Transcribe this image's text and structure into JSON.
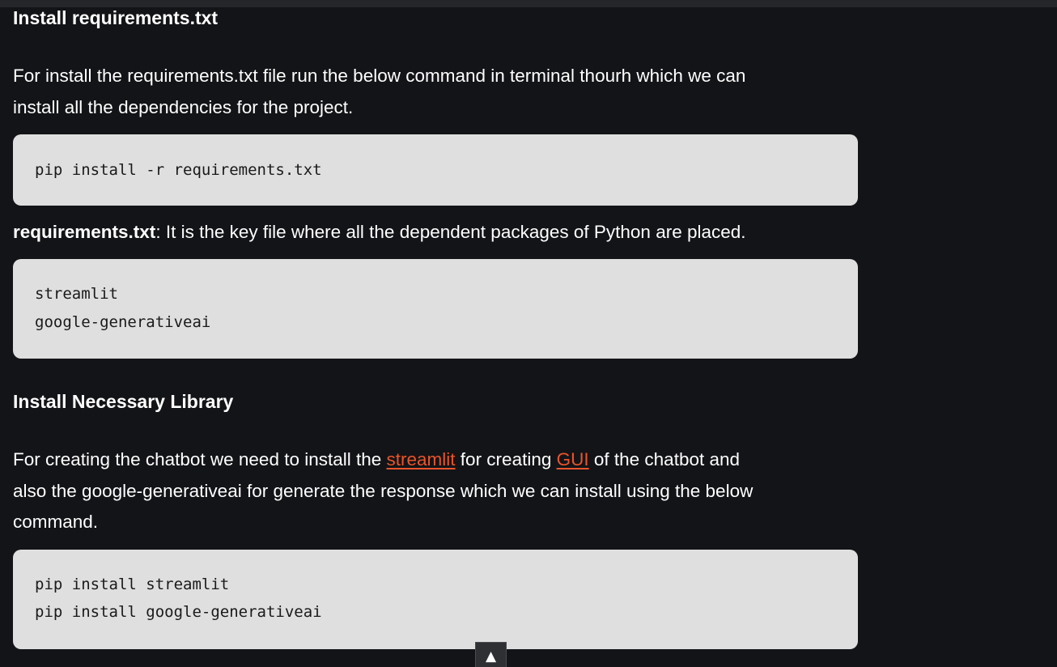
{
  "article": {
    "section1": {
      "heading": "Install requirements.txt",
      "para_line1": "For install the requirements.txt file run the below command in terminal thourh which we can",
      "para_line2": "install all the dependencies for the project.",
      "code1": [
        "pip install -r requirements.txt"
      ],
      "note_bold": "requirements.txt",
      "note_text": ": It is the key file where all the dependent packages of Python are placed.",
      "code2": [
        "streamlit",
        "google-generativeai"
      ]
    },
    "section2": {
      "heading": "Install Necessary Library",
      "para_part1": "For creating the chatbot we need to install the ",
      "link1": "streamlit",
      "para_part2": " for creating ",
      "link2": "GUI",
      "para_part3": " of the chatbot and",
      "para_line2": "also the google-generativeai for generate the response which we can install using the below",
      "para_line3": "command.",
      "code3": [
        "pip install streamlit",
        "pip install google-generativeai"
      ]
    }
  },
  "scroll_top": {
    "icon": "arrow-up-icon",
    "glyph": "▲"
  },
  "colors": {
    "background": "#131417",
    "code_background": "#dfdfdf",
    "link": "#e9542b",
    "text": "#ffffff"
  }
}
